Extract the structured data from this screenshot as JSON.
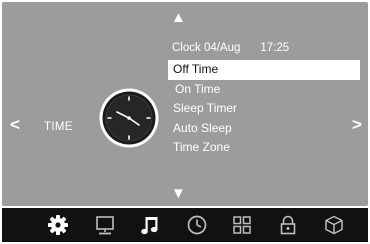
{
  "nav": {
    "up": "▲",
    "down": "▼",
    "left": "<",
    "right": ">"
  },
  "category": {
    "label": "TIME",
    "icon": "clock-icon"
  },
  "status": {
    "date": "Clock 04/Aug",
    "time": "17:25"
  },
  "menu": {
    "items": [
      {
        "label": "Off Time",
        "selected": true
      },
      {
        "label": "On Time",
        "selected": false
      },
      {
        "label": "Sleep Timer",
        "selected": false
      },
      {
        "label": "Auto Sleep",
        "selected": false
      },
      {
        "label": "Time Zone",
        "selected": false
      }
    ]
  },
  "tabs": [
    {
      "icon": "gear-icon",
      "name": "picture-settings",
      "active": true
    },
    {
      "icon": "monitor-icon",
      "name": "screen",
      "active": false
    },
    {
      "icon": "music-note-icon",
      "name": "sound",
      "active": false
    },
    {
      "icon": "clock-icon",
      "name": "time",
      "active": false
    },
    {
      "icon": "grid-icon",
      "name": "setup",
      "active": false
    },
    {
      "icon": "lock-icon",
      "name": "lock",
      "active": false
    },
    {
      "icon": "cube-icon",
      "name": "app",
      "active": false
    }
  ],
  "colors": {
    "panel": "#9c9c9c",
    "bar": "#111111",
    "highlight": "#ffffff",
    "text": "#ffffff"
  }
}
